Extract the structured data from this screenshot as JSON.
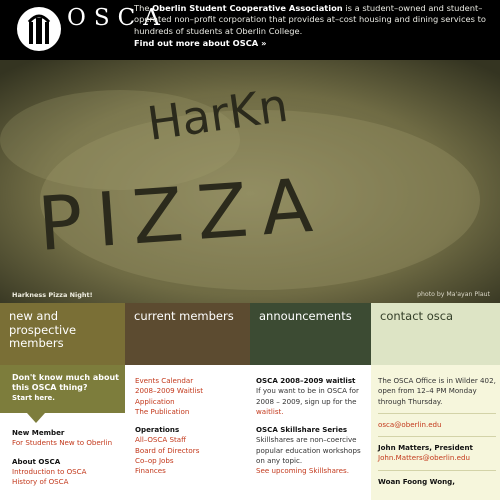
{
  "header": {
    "logo_letters_top": "OSCA",
    "logo_letters_bottom": "",
    "intro_pre": "The ",
    "intro_org": "Oberlin Student Cooperative Association",
    "intro_post": " is a student–owned and student–operated non–profit corporation that provides at–cost housing and dining services to hundreds of students at Oberlin College.",
    "find_out_more": "Find out more about OSCA »"
  },
  "hero": {
    "flour_text_top": "HarKn",
    "flour_text_bottom": "PIZZA",
    "caption": "Harkness Pizza Night!",
    "credit": "photo by Ma'ayan Plaut"
  },
  "columns": [
    {
      "title": "new and prospective members"
    },
    {
      "title": "current members"
    },
    {
      "title": "announcements"
    },
    {
      "title": "contact osca"
    }
  ],
  "new_members": {
    "callout_question": "Don't know much about this OSCA thing?",
    "callout_start": "Start here.",
    "section1_heading": "New Member",
    "section1_link": "For Students New to Oberlin",
    "section2_heading": "About OSCA",
    "section2_links": [
      "Introduction to OSCA",
      "History of OSCA"
    ]
  },
  "current_members": {
    "links": [
      "Events Calendar",
      "2008–2009 Waitlist",
      "Application",
      "The Publication"
    ],
    "ops_heading": "Operations",
    "ops_links": [
      "All–OSCA Staff",
      "Board of Directors",
      "Co–op Jobs",
      "Finances"
    ]
  },
  "announcements": {
    "item1_title": "OSCA 2008–2009 waitlist",
    "item1_text": "If you want to be in OSCA for 2008 – 2009, sign up for the",
    "item1_link": "waitlist.",
    "item2_title": "OSCA Skillshare Series",
    "item2_text": "Skillshares are non–coercive popular education workshops on any topic.",
    "item2_link": "See upcoming Skillshares."
  },
  "contact": {
    "office_text": "The OSCA Office is in Wilder 402, open from 12–4 PM Monday through Thursday.",
    "email": "osca@oberlin.edu",
    "person1_name": "John Matters, President",
    "person1_email": "John.Matters@oberlin.edu",
    "person2_name": "Woan Foong Wong,"
  },
  "colors": {
    "header_bg": "#000000",
    "col1": "#7a6f36",
    "col2": "#5c4b30",
    "col3": "#3c4b33",
    "col4": "#dde4c5",
    "link_red": "#c3391c"
  }
}
